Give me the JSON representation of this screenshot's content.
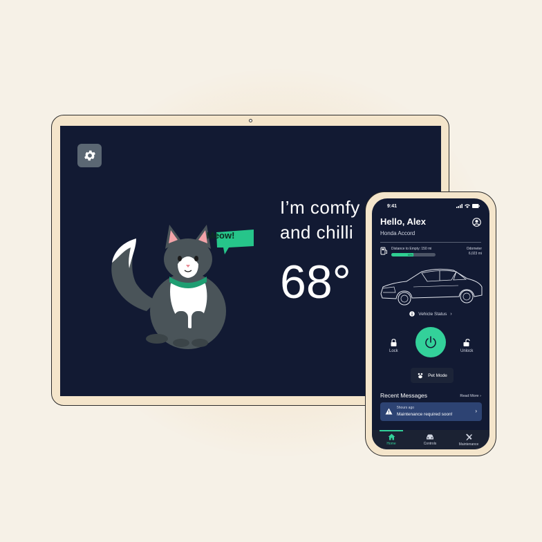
{
  "tablet": {
    "headline_line1": "I’m comfy",
    "headline_line2": "and chilli",
    "temperature": "68°",
    "speech_bubble": "Meow!",
    "settings_icon": "gear-icon"
  },
  "phone": {
    "status_time": "9:41",
    "greeting": "Hello, Alex",
    "car_model": "Honda Accord",
    "distance_label": "Distance to Empty: 150 mi",
    "fuel_percent_label": "60%",
    "fuel_fraction": 0.5,
    "odometer_label": "Odometer",
    "odometer_value": "6,023 mi",
    "vehicle_status_label": "Vehicle Status",
    "lock_label": "Lock",
    "unlock_label": "Unlock",
    "pet_mode_label": "Pet Mode",
    "recent_messages_title": "Recent Messages",
    "read_more_label": "Read More",
    "message": {
      "time": "5hours ago",
      "text": "Maintenance required soon!"
    },
    "tabs": [
      {
        "label": "Home",
        "icon": "home-icon",
        "active": true
      },
      {
        "label": "Controls",
        "icon": "car-controls-icon",
        "active": false
      },
      {
        "label": "Maintenance",
        "icon": "wrench-icon",
        "active": false
      }
    ]
  },
  "colors": {
    "background": "#f6f1e7",
    "screen": "#121a33",
    "accent_green": "#33d19a",
    "message_card": "#2d4373",
    "device_frame": "#f4e5cb"
  }
}
